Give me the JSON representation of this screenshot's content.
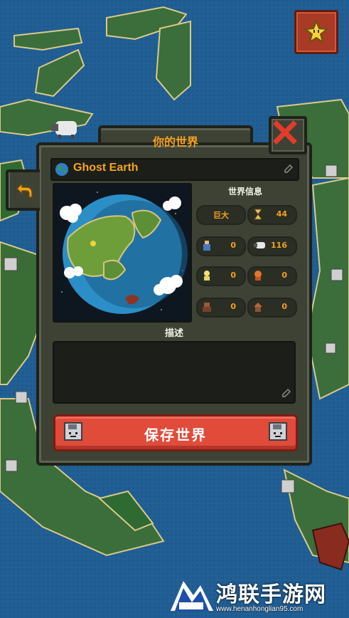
{
  "dialog": {
    "title": "你的世界",
    "world_name": "Ghost Earth",
    "info_title": "世界信息",
    "description_title": "描述",
    "save_label": "保存世界"
  },
  "stats": {
    "size": "巨大",
    "age": "44",
    "humans": "0",
    "animals": "116",
    "elves": "0",
    "dwarves": "0",
    "orcs": "0",
    "villages": "0"
  },
  "icons": {
    "star": "star-icon",
    "close": "close-icon",
    "back": "back-arrow-icon",
    "globe": "globe-icon",
    "edit": "pencil-icon",
    "save": "floppy-disk-icon"
  },
  "colors": {
    "accent": "#f3a21b",
    "save_button": "#e04b3a",
    "close_x": "#e23b2c",
    "panel": "#3d4234",
    "ocean": "#1f5f93"
  },
  "watermark": {
    "title": "鸿联手游网",
    "url": "www.henanhonglian95.com"
  }
}
